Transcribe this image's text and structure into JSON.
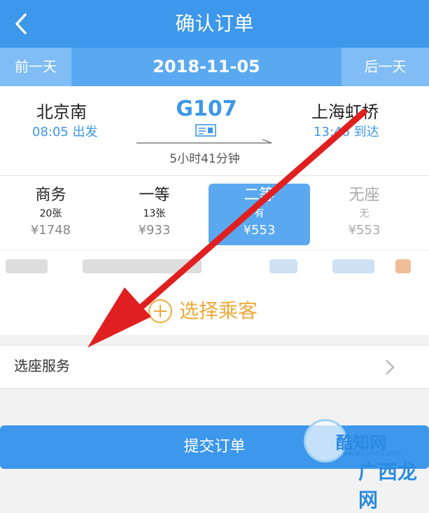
{
  "header": {
    "title": "确认订单"
  },
  "datebar": {
    "prev": "前一天",
    "date": "2018-11-05",
    "next": "后一天"
  },
  "train": {
    "from_station": "北京南",
    "depart_time": "08:05 出发",
    "number": "G107",
    "duration": "5小时41分钟",
    "to_station": "上海虹桥",
    "arrive_time": "13:46 到达"
  },
  "seats": [
    {
      "name": "商务",
      "count": "20张",
      "price": "¥1748"
    },
    {
      "name": "一等",
      "count": "13张",
      "price": "¥933"
    },
    {
      "name": "二等",
      "count": "有",
      "price": "¥553"
    },
    {
      "name": "无座",
      "count": "无",
      "price": "¥553"
    }
  ],
  "passenger": {
    "add_label": "选择乘客"
  },
  "seat_service": {
    "label": "选座服务"
  },
  "submit": {
    "label": "提交订单"
  },
  "watermark": {
    "line1": "酷知网",
    "line2": "www.coozhi.com",
    "line3": "广西龙网"
  },
  "colors": {
    "primary": "#3d97ea",
    "accent": "#f0a93b",
    "annotation_arrow": "#e02020"
  }
}
